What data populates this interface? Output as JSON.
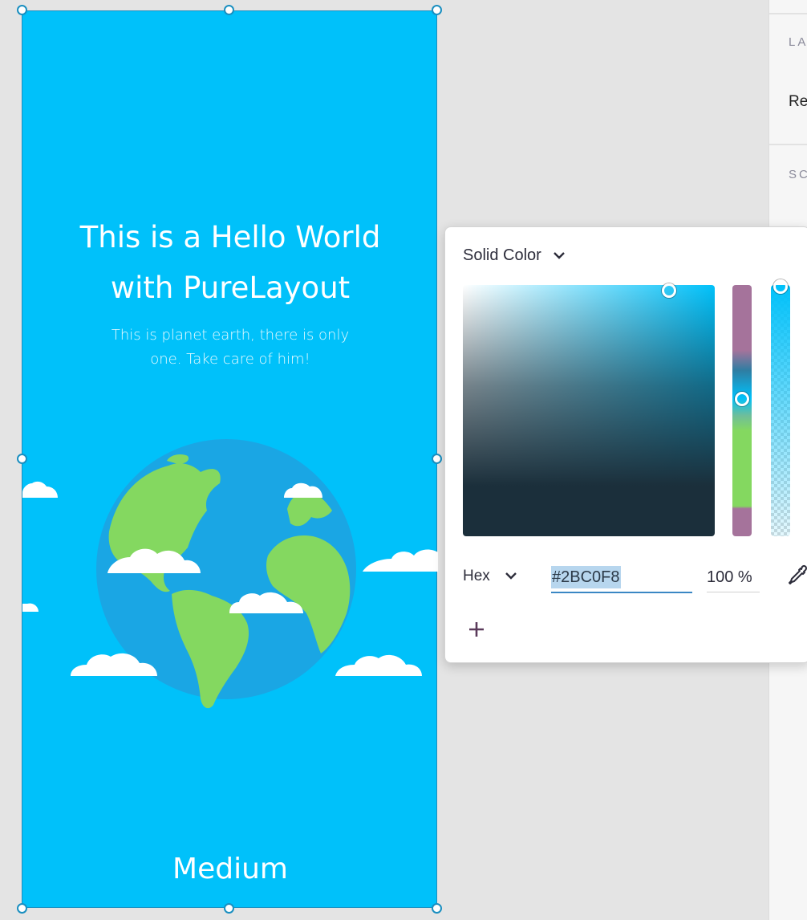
{
  "inspector": {
    "section1_label": "LA",
    "section1_value": "Re",
    "section2_label": "SC"
  },
  "artboard": {
    "background": "#00c1fa",
    "headline_line1": "This is a Hello World",
    "headline_line2": "with PureLayout",
    "subtext_line1": "This is planet earth, there is only",
    "subtext_line2": "one. Take care of him!",
    "brand": "Medium"
  },
  "color_picker": {
    "fill_type": "Solid Color",
    "format": "Hex",
    "hex_value": "#2BC0F8",
    "opacity": "100 %",
    "icons": {
      "fill_type_dropdown": "chevron-down-icon",
      "format_dropdown": "chevron-down-icon",
      "eyedropper": "eyedropper-icon",
      "add": "plus-icon"
    }
  },
  "colors": {
    "canvas": "#e4e4e4",
    "selection": "#1b8fc0",
    "land": "#84d860",
    "ocean": "#1aa6e4",
    "cloud": "#ffffff"
  }
}
